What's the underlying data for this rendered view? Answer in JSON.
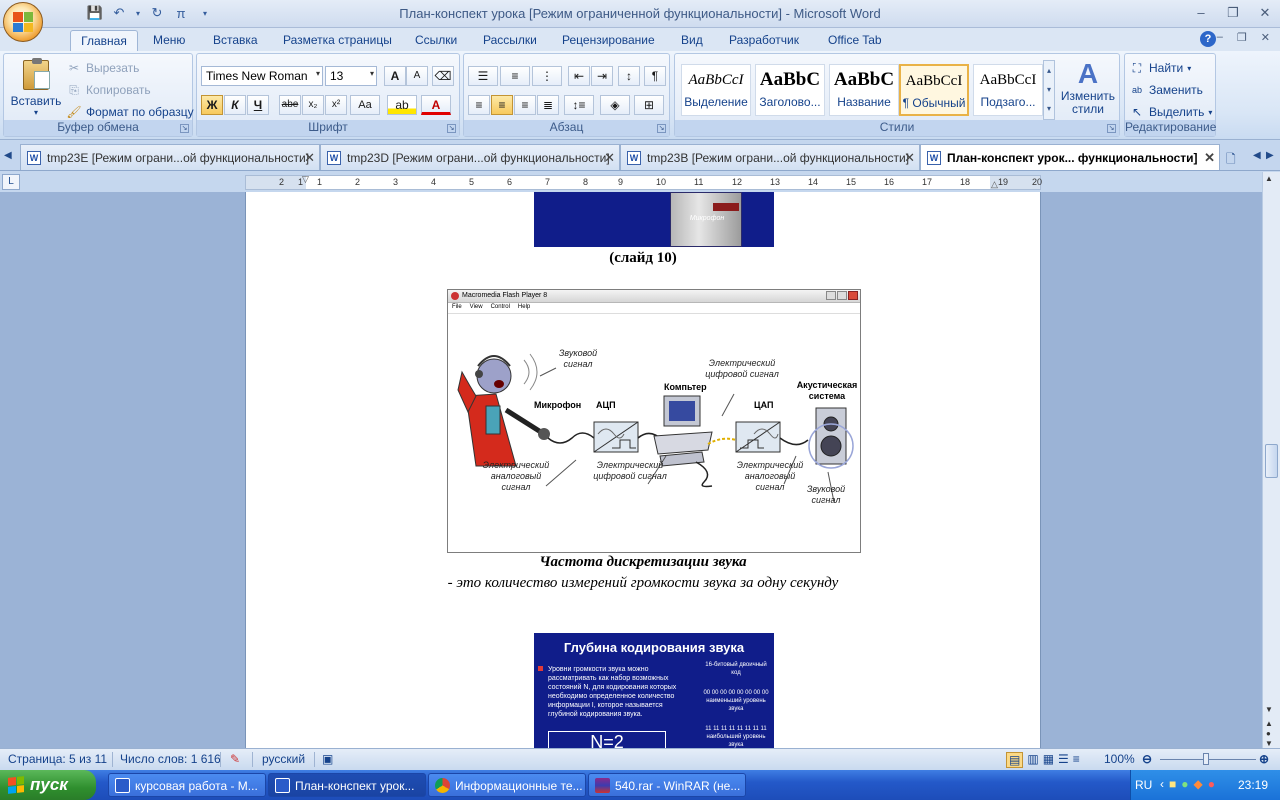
{
  "window": {
    "title": "План-конспект урока [Режим ограниченной функциональности] - Microsoft Word"
  },
  "ribbon_tabs": [
    "Главная",
    "Меню",
    "Вставка",
    "Разметка страницы",
    "Ссылки",
    "Рассылки",
    "Рецензирование",
    "Вид",
    "Разработчик",
    "Office Tab"
  ],
  "clipboard": {
    "paste": "Вставить",
    "cut": "Вырезать",
    "copy": "Копировать",
    "format_painter": "Формат по образцу",
    "label": "Буфер обмена"
  },
  "font": {
    "name": "Times New Roman",
    "size": "13",
    "label": "Шрифт",
    "bold": "Ж",
    "italic": "К",
    "underline": "Ч",
    "strike": "abe",
    "sub": "x₂",
    "sup": "x²",
    "case": "Aa",
    "grow": "A",
    "shrink": "A"
  },
  "paragraph": {
    "label": "Абзац"
  },
  "styles": {
    "items": [
      {
        "sample": "AaBbCcI",
        "name": "Выделение"
      },
      {
        "sample": "AaBbC",
        "name": "Заголово..."
      },
      {
        "sample": "AaBbC",
        "name": "Название"
      },
      {
        "sample": "AaBbCcI",
        "name": "¶ Обычный"
      },
      {
        "sample": "AaBbCcI",
        "name": "Подзаго..."
      }
    ],
    "change_styles": "Изменить стили",
    "label": "Стили"
  },
  "editing": {
    "find": "Найти",
    "replace": "Заменить",
    "select": "Выделить",
    "label": "Редактирование"
  },
  "doc_tabs": [
    {
      "label": "tmp23E [Режим ограни...ой функциональности]"
    },
    {
      "label": "tmp23D [Режим ограни...ой функциональности]"
    },
    {
      "label": "tmp23B [Режим ограни...ой функциональности]"
    },
    {
      "label": "План-конспект урок... функциональности]"
    }
  ],
  "ruler": {
    "numbers": [
      "2",
      "1",
      "1",
      "2",
      "3",
      "4",
      "5",
      "6",
      "7",
      "8",
      "9",
      "10",
      "11",
      "12",
      "13",
      "14",
      "15",
      "16",
      "17",
      "18",
      "19",
      "20"
    ]
  },
  "document": {
    "slide_caption": "(слайд 10)",
    "mic_label": "Микрофон",
    "flash_window": {
      "title": "Macromedia Flash Player 8",
      "menu": [
        "File",
        "View",
        "Control",
        "Help"
      ],
      "labels": {
        "sound_signal_top": "Звуковой сигнал",
        "microphone": "Микрофон",
        "adc": "АЦП",
        "computer": "Компьтер",
        "digital_signal_top": "Электрический цифровой сигнал",
        "dac": "ЦАП",
        "speaker": "Акустическая система",
        "analog_left": "Электрический аналоговый сигнал",
        "digital_bottom": "Электрический цифровой сигнал",
        "analog_right": "Электрический аналоговый сигнал",
        "sound_signal_bottom": "Звуковой сигнал"
      }
    },
    "heading": "Частота дискретизации звука",
    "definition": "- это количество измерений громкости звука за одну секунду",
    "slide2": {
      "title": "Глубина кодирования звука",
      "bullet": "Уровни громкости звука можно рассматривать как набор возможных состояний N, для кодирования которых необходимо определенное количество информации I, которое называется глубиной кодирования звука.",
      "right1": "16-битовый двоичный код",
      "right2": "00 00 00 00 00 00 00 00",
      "right3": "наименьший уровень звука",
      "right4": "11 11 11 11 11 11 11 11",
      "right5": "наибольший уровень звука",
      "formula": "N=2"
    }
  },
  "status": {
    "page": "Страница: 5 из 11",
    "words": "Число слов: 1 616",
    "lang": "русский",
    "zoom": "100%"
  },
  "taskbar": {
    "start": "пуск",
    "tasks": [
      {
        "label": "курсовая работа - M..."
      },
      {
        "label": "План-конспект урок..."
      },
      {
        "label": "Информационные те..."
      },
      {
        "label": "540.rar - WinRAR (не..."
      }
    ],
    "lang": "RU",
    "time": "23:19"
  },
  "colors": {
    "ribbon_bg": "#dbe6f4",
    "slide_blue": "#101d8a",
    "taskbar": "#2459c9",
    "start_green": "#2f8f2e"
  }
}
